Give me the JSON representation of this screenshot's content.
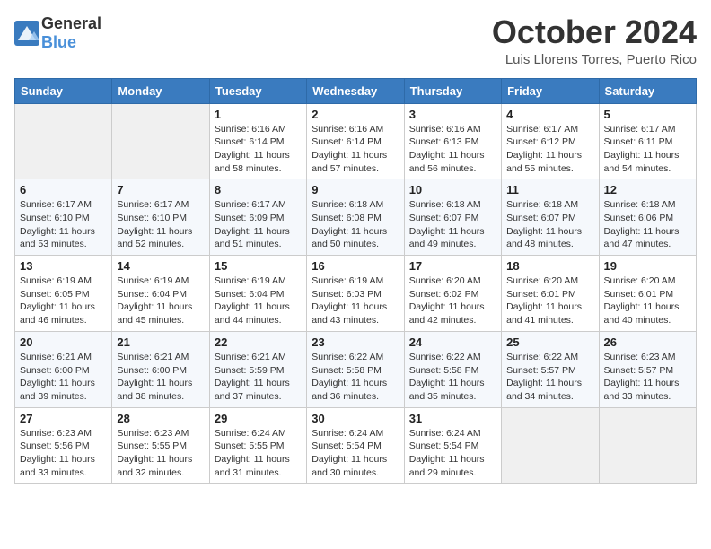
{
  "header": {
    "logo_general": "General",
    "logo_blue": "Blue",
    "month_title": "October 2024",
    "location": "Luis Llorens Torres, Puerto Rico"
  },
  "weekdays": [
    "Sunday",
    "Monday",
    "Tuesday",
    "Wednesday",
    "Thursday",
    "Friday",
    "Saturday"
  ],
  "weeks": [
    [
      {
        "day": "",
        "sunrise": "",
        "sunset": "",
        "daylight": ""
      },
      {
        "day": "",
        "sunrise": "",
        "sunset": "",
        "daylight": ""
      },
      {
        "day": "1",
        "sunrise": "Sunrise: 6:16 AM",
        "sunset": "Sunset: 6:14 PM",
        "daylight": "Daylight: 11 hours and 58 minutes."
      },
      {
        "day": "2",
        "sunrise": "Sunrise: 6:16 AM",
        "sunset": "Sunset: 6:14 PM",
        "daylight": "Daylight: 11 hours and 57 minutes."
      },
      {
        "day": "3",
        "sunrise": "Sunrise: 6:16 AM",
        "sunset": "Sunset: 6:13 PM",
        "daylight": "Daylight: 11 hours and 56 minutes."
      },
      {
        "day": "4",
        "sunrise": "Sunrise: 6:17 AM",
        "sunset": "Sunset: 6:12 PM",
        "daylight": "Daylight: 11 hours and 55 minutes."
      },
      {
        "day": "5",
        "sunrise": "Sunrise: 6:17 AM",
        "sunset": "Sunset: 6:11 PM",
        "daylight": "Daylight: 11 hours and 54 minutes."
      }
    ],
    [
      {
        "day": "6",
        "sunrise": "Sunrise: 6:17 AM",
        "sunset": "Sunset: 6:10 PM",
        "daylight": "Daylight: 11 hours and 53 minutes."
      },
      {
        "day": "7",
        "sunrise": "Sunrise: 6:17 AM",
        "sunset": "Sunset: 6:10 PM",
        "daylight": "Daylight: 11 hours and 52 minutes."
      },
      {
        "day": "8",
        "sunrise": "Sunrise: 6:17 AM",
        "sunset": "Sunset: 6:09 PM",
        "daylight": "Daylight: 11 hours and 51 minutes."
      },
      {
        "day": "9",
        "sunrise": "Sunrise: 6:18 AM",
        "sunset": "Sunset: 6:08 PM",
        "daylight": "Daylight: 11 hours and 50 minutes."
      },
      {
        "day": "10",
        "sunrise": "Sunrise: 6:18 AM",
        "sunset": "Sunset: 6:07 PM",
        "daylight": "Daylight: 11 hours and 49 minutes."
      },
      {
        "day": "11",
        "sunrise": "Sunrise: 6:18 AM",
        "sunset": "Sunset: 6:07 PM",
        "daylight": "Daylight: 11 hours and 48 minutes."
      },
      {
        "day": "12",
        "sunrise": "Sunrise: 6:18 AM",
        "sunset": "Sunset: 6:06 PM",
        "daylight": "Daylight: 11 hours and 47 minutes."
      }
    ],
    [
      {
        "day": "13",
        "sunrise": "Sunrise: 6:19 AM",
        "sunset": "Sunset: 6:05 PM",
        "daylight": "Daylight: 11 hours and 46 minutes."
      },
      {
        "day": "14",
        "sunrise": "Sunrise: 6:19 AM",
        "sunset": "Sunset: 6:04 PM",
        "daylight": "Daylight: 11 hours and 45 minutes."
      },
      {
        "day": "15",
        "sunrise": "Sunrise: 6:19 AM",
        "sunset": "Sunset: 6:04 PM",
        "daylight": "Daylight: 11 hours and 44 minutes."
      },
      {
        "day": "16",
        "sunrise": "Sunrise: 6:19 AM",
        "sunset": "Sunset: 6:03 PM",
        "daylight": "Daylight: 11 hours and 43 minutes."
      },
      {
        "day": "17",
        "sunrise": "Sunrise: 6:20 AM",
        "sunset": "Sunset: 6:02 PM",
        "daylight": "Daylight: 11 hours and 42 minutes."
      },
      {
        "day": "18",
        "sunrise": "Sunrise: 6:20 AM",
        "sunset": "Sunset: 6:01 PM",
        "daylight": "Daylight: 11 hours and 41 minutes."
      },
      {
        "day": "19",
        "sunrise": "Sunrise: 6:20 AM",
        "sunset": "Sunset: 6:01 PM",
        "daylight": "Daylight: 11 hours and 40 minutes."
      }
    ],
    [
      {
        "day": "20",
        "sunrise": "Sunrise: 6:21 AM",
        "sunset": "Sunset: 6:00 PM",
        "daylight": "Daylight: 11 hours and 39 minutes."
      },
      {
        "day": "21",
        "sunrise": "Sunrise: 6:21 AM",
        "sunset": "Sunset: 6:00 PM",
        "daylight": "Daylight: 11 hours and 38 minutes."
      },
      {
        "day": "22",
        "sunrise": "Sunrise: 6:21 AM",
        "sunset": "Sunset: 5:59 PM",
        "daylight": "Daylight: 11 hours and 37 minutes."
      },
      {
        "day": "23",
        "sunrise": "Sunrise: 6:22 AM",
        "sunset": "Sunset: 5:58 PM",
        "daylight": "Daylight: 11 hours and 36 minutes."
      },
      {
        "day": "24",
        "sunrise": "Sunrise: 6:22 AM",
        "sunset": "Sunset: 5:58 PM",
        "daylight": "Daylight: 11 hours and 35 minutes."
      },
      {
        "day": "25",
        "sunrise": "Sunrise: 6:22 AM",
        "sunset": "Sunset: 5:57 PM",
        "daylight": "Daylight: 11 hours and 34 minutes."
      },
      {
        "day": "26",
        "sunrise": "Sunrise: 6:23 AM",
        "sunset": "Sunset: 5:57 PM",
        "daylight": "Daylight: 11 hours and 33 minutes."
      }
    ],
    [
      {
        "day": "27",
        "sunrise": "Sunrise: 6:23 AM",
        "sunset": "Sunset: 5:56 PM",
        "daylight": "Daylight: 11 hours and 33 minutes."
      },
      {
        "day": "28",
        "sunrise": "Sunrise: 6:23 AM",
        "sunset": "Sunset: 5:55 PM",
        "daylight": "Daylight: 11 hours and 32 minutes."
      },
      {
        "day": "29",
        "sunrise": "Sunrise: 6:24 AM",
        "sunset": "Sunset: 5:55 PM",
        "daylight": "Daylight: 11 hours and 31 minutes."
      },
      {
        "day": "30",
        "sunrise": "Sunrise: 6:24 AM",
        "sunset": "Sunset: 5:54 PM",
        "daylight": "Daylight: 11 hours and 30 minutes."
      },
      {
        "day": "31",
        "sunrise": "Sunrise: 6:24 AM",
        "sunset": "Sunset: 5:54 PM",
        "daylight": "Daylight: 11 hours and 29 minutes."
      },
      {
        "day": "",
        "sunrise": "",
        "sunset": "",
        "daylight": ""
      },
      {
        "day": "",
        "sunrise": "",
        "sunset": "",
        "daylight": ""
      }
    ]
  ]
}
